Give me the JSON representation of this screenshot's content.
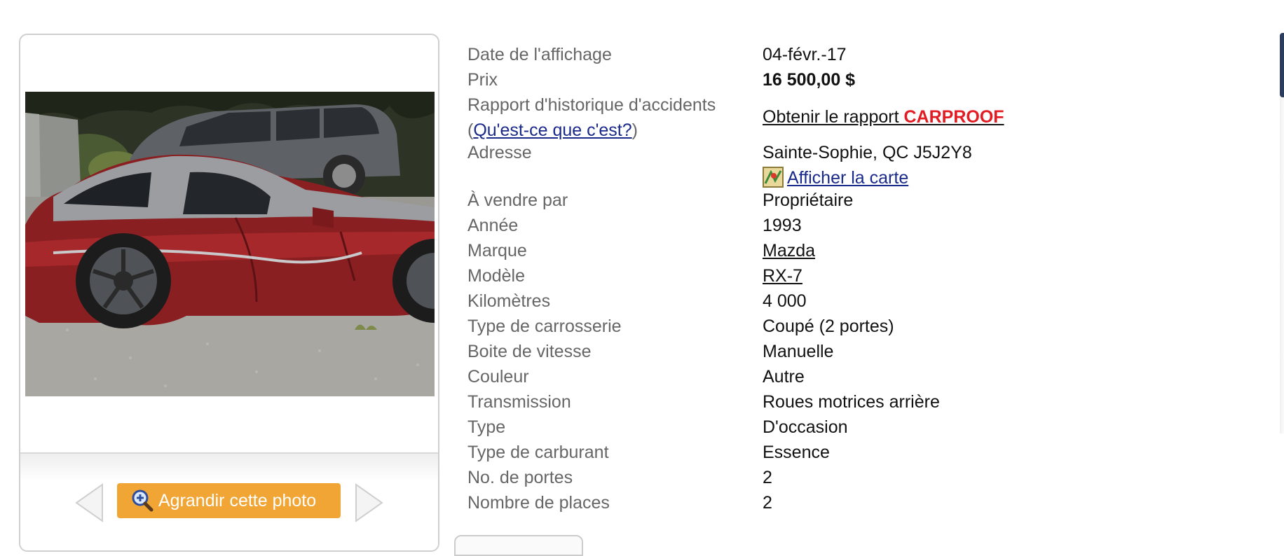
{
  "photo_panel": {
    "enlarge_button_label": "Agrandir cette photo",
    "prev_icon": "chevron-left-icon",
    "next_icon": "chevron-right-icon",
    "zoom_icon": "magnifier-plus-icon"
  },
  "details": {
    "date_label": "Date de l'affichage",
    "date_value": "04-févr.-17",
    "price_label": "Prix",
    "price_value": "16 500,00 $",
    "accident_label_line1": "Rapport d'historique d'accidents",
    "accident_help_open": "(",
    "accident_help_link": "Qu'est-ce que c'est?",
    "accident_help_close": ")",
    "accident_link_text": "Obtenir le rapport",
    "accident_link_brand": "CARPROOF",
    "address_label": "Adresse",
    "address_value": "Sainte-Sophie, QC J5J2Y8",
    "map_link": "Afficher la carte",
    "seller_label": "À vendre par",
    "seller_value": "Propriétaire",
    "year_label": "Année",
    "year_value": "1993",
    "make_label": "Marque",
    "make_value": "Mazda",
    "model_label": "Modèle",
    "model_value": "RX-7",
    "km_label": "Kilomètres",
    "km_value": "4 000",
    "body_label": "Type de carrosserie",
    "body_value": "Coupé (2 portes)",
    "transmission_box_label": "Boite de vitesse",
    "transmission_box_value": "Manuelle",
    "color_label": "Couleur",
    "color_value": "Autre",
    "drivetrain_label": "Transmission",
    "drivetrain_value": "Roues motrices arrière",
    "type_label": "Type",
    "type_value": "D'occasion",
    "fuel_label": "Type de carburant",
    "fuel_value": "Essence",
    "doors_label": "No. de portes",
    "doors_value": "2",
    "seats_label": "Nombre de places",
    "seats_value": "2"
  },
  "colors": {
    "accent_orange": "#f0a534",
    "link_blue": "#1a2a8a",
    "carproof_red": "#e31b23",
    "label_gray": "#666666"
  }
}
